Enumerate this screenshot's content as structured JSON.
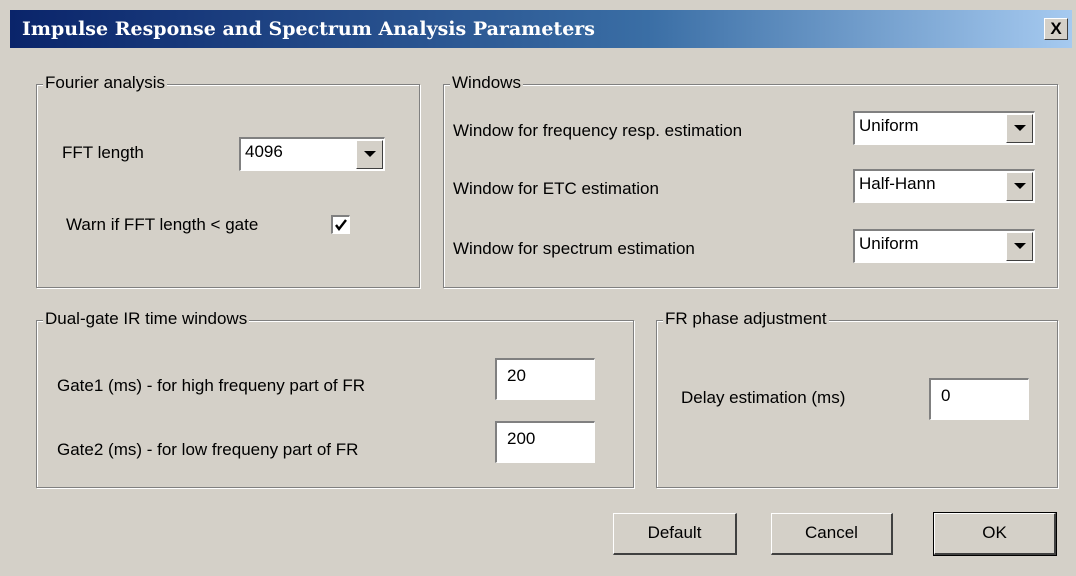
{
  "window": {
    "title": "Impulse Response and Spectrum Analysis Parameters",
    "close_label": "X"
  },
  "fourier": {
    "legend": "Fourier analysis",
    "fft_length_label": "FFT length",
    "fft_length_value": "4096",
    "warn_label": "Warn if FFT length < gate",
    "warn_checked": true
  },
  "windows": {
    "legend": "Windows",
    "freq_resp_label": "Window for frequency resp. estimation",
    "freq_resp_value": "Uniform",
    "etc_label": "Window for ETC estimation",
    "etc_value": "Half-Hann",
    "spectrum_label": "Window for spectrum estimation",
    "spectrum_value": "Uniform"
  },
  "dual_gate": {
    "legend": "Dual-gate IR time windows",
    "gate1_label": "Gate1 (ms) - for high frequeny part of FR",
    "gate1_value": "20",
    "gate2_label": "Gate2 (ms) - for low frequeny part of  FR",
    "gate2_value": "200"
  },
  "phase": {
    "legend": "FR phase adjustment",
    "delay_label": "Delay estimation (ms)",
    "delay_value": "0"
  },
  "buttons": {
    "default": "Default",
    "cancel": "Cancel",
    "ok": "OK"
  }
}
